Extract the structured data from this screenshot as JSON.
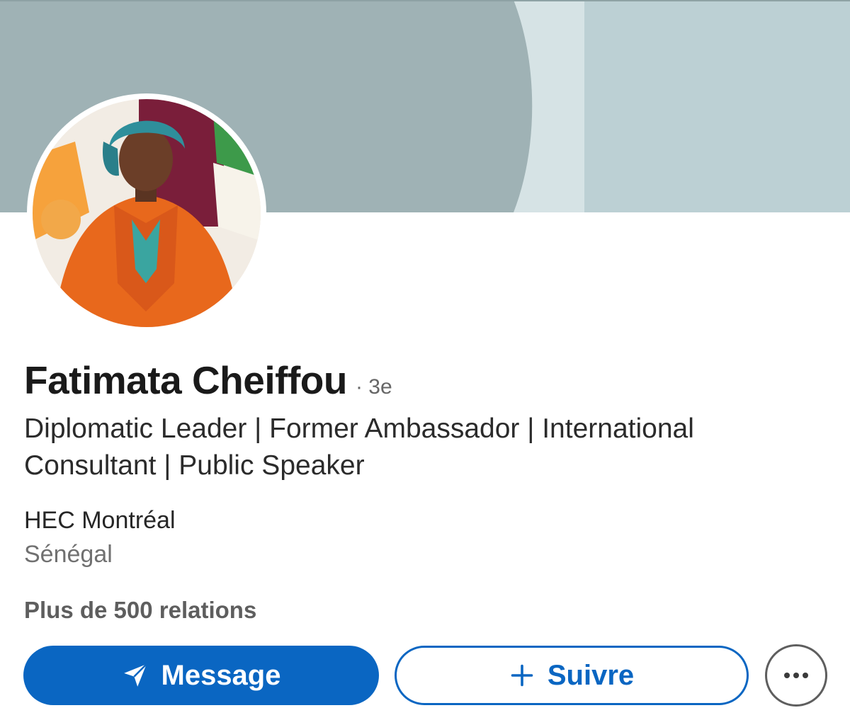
{
  "profile": {
    "name": "Fatimata Cheiffou",
    "degree": "· 3e",
    "headline": "Diplomatic Leader | Former Ambassador | International Consultant | Public Speaker",
    "school": "HEC Montréal",
    "location": "Sénégal",
    "connections": "Plus de 500 relations"
  },
  "actions": {
    "message_label": "Message",
    "follow_label": "Suivre",
    "more_icon": "more-horizontal-icon"
  },
  "colors": {
    "primary": "#0a66c2",
    "banner_left": "#9fb2b5",
    "banner_middle": "#d6e3e5",
    "banner_right": "#bcd0d4"
  }
}
